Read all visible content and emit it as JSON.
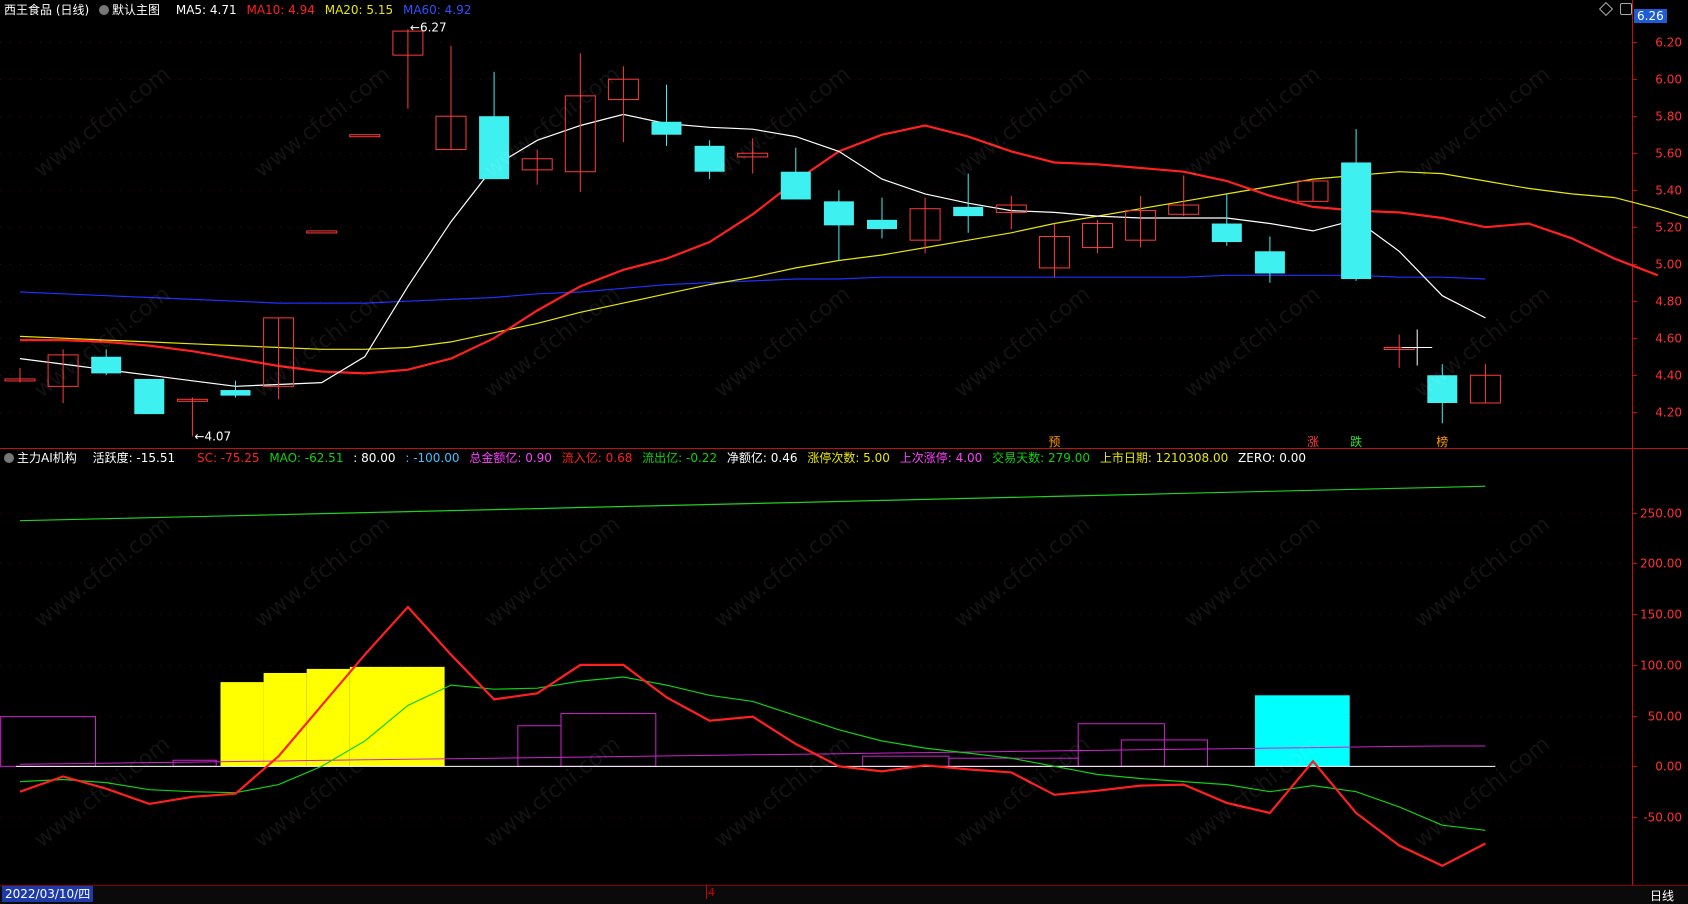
{
  "header": {
    "stock_name": "西王食品 (日线)",
    "template": "默认主图",
    "ma5": "MA5: 4.71",
    "ma10": "MA10: 4.94",
    "ma20": "MA20: 5.15",
    "ma60": "MA60: 4.92"
  },
  "current_price": "6.26",
  "indicator_header": {
    "name": "主力AI机构",
    "activity": "活跃度: -15.51",
    "sc": "SC: -75.25",
    "mao": "MAO: -62.51",
    "level80": ": 80.00",
    "level_neg100": ": -100.00",
    "total_amount": "总金额亿: 0.90",
    "inflow": "流入亿: 0.68",
    "outflow": "流出亿: -0.22",
    "net": "净额亿: 0.46",
    "limit_up_count": "涨停次数: 5.00",
    "last_limit": "上次涨停: 4.00",
    "trade_days": "交易天数: 279.00",
    "list_date": "上市日期: 1210308.00",
    "zero": "ZERO: 0.00"
  },
  "bottom": {
    "date": "2022/03/10/四",
    "period": "日线",
    "cursor_label": "4"
  },
  "watermark": "www.cfchi.com",
  "colors": {
    "up": "#ff3b3b",
    "down": "#3ff0f0",
    "ma5": "#ffffff",
    "ma10": "#ff2020",
    "ma20": "#e8e800",
    "ma60": "#2030ff",
    "sc": "#ff2020",
    "mao": "#10d010",
    "bg": "#000000",
    "axis": "#c01010"
  },
  "chart_data": [
    {
      "type": "candlestick",
      "ylim": [
        4.05,
        6.32
      ],
      "y_ticks": [
        4.2,
        4.4,
        4.6,
        4.8,
        5.0,
        5.2,
        5.4,
        5.6,
        5.8,
        6.0,
        6.2
      ],
      "annotations": [
        {
          "text": "6.27",
          "index": 9
        },
        {
          "text": "4.07",
          "index": 4
        }
      ],
      "markers": [
        {
          "text": "预",
          "index": 24,
          "color": "#ff9900"
        },
        {
          "text": "涨",
          "index": 30,
          "color": "#ff3b3b"
        },
        {
          "text": "跌",
          "index": 31,
          "color": "#30e030"
        },
        {
          "text": "榜",
          "index": 33,
          "color": "#ff9900"
        }
      ],
      "candles": [
        {
          "o": 4.37,
          "c": 4.38,
          "h": 4.44,
          "l": 4.36
        },
        {
          "o": 4.34,
          "c": 4.51,
          "h": 4.54,
          "l": 4.25
        },
        {
          "o": 4.5,
          "c": 4.41,
          "h": 4.54,
          "l": 4.4
        },
        {
          "o": 4.38,
          "c": 4.19,
          "h": 4.38,
          "l": 4.19
        },
        {
          "o": 4.27,
          "c": 4.27,
          "h": 4.28,
          "l": 4.07
        },
        {
          "o": 4.32,
          "c": 4.29,
          "h": 4.37,
          "l": 4.28
        },
        {
          "o": 4.34,
          "c": 4.71,
          "h": 4.71,
          "l": 4.27
        },
        {
          "o": 5.18,
          "c": 5.18,
          "h": 5.18,
          "l": 5.18
        },
        {
          "o": 5.7,
          "c": 5.7,
          "h": 5.7,
          "l": 5.7
        },
        {
          "o": 6.13,
          "c": 6.26,
          "h": 6.27,
          "l": 5.84
        },
        {
          "o": 5.62,
          "c": 5.8,
          "h": 6.18,
          "l": 5.62
        },
        {
          "o": 5.8,
          "c": 5.46,
          "h": 6.04,
          "l": 5.46
        },
        {
          "o": 5.51,
          "c": 5.57,
          "h": 5.62,
          "l": 5.43
        },
        {
          "o": 5.5,
          "c": 5.91,
          "h": 6.14,
          "l": 5.39
        },
        {
          "o": 5.89,
          "c": 6.0,
          "h": 6.07,
          "l": 5.66
        },
        {
          "o": 5.77,
          "c": 5.7,
          "h": 5.97,
          "l": 5.64
        },
        {
          "o": 5.64,
          "c": 5.5,
          "h": 5.67,
          "l": 5.46
        },
        {
          "o": 5.58,
          "c": 5.6,
          "h": 5.68,
          "l": 5.49
        },
        {
          "o": 5.5,
          "c": 5.35,
          "h": 5.63,
          "l": 5.35
        },
        {
          "o": 5.34,
          "c": 5.21,
          "h": 5.4,
          "l": 5.02
        },
        {
          "o": 5.24,
          "c": 5.19,
          "h": 5.36,
          "l": 5.14
        },
        {
          "o": 5.13,
          "c": 5.3,
          "h": 5.36,
          "l": 5.06
        },
        {
          "o": 5.31,
          "c": 5.26,
          "h": 5.49,
          "l": 5.17
        },
        {
          "o": 5.28,
          "c": 5.32,
          "h": 5.37,
          "l": 5.19
        },
        {
          "o": 4.98,
          "c": 5.15,
          "h": 5.22,
          "l": 4.93
        },
        {
          "o": 5.09,
          "c": 5.22,
          "h": 5.24,
          "l": 5.06
        },
        {
          "o": 5.13,
          "c": 5.29,
          "h": 5.37,
          "l": 5.09
        },
        {
          "o": 5.27,
          "c": 5.32,
          "h": 5.48,
          "l": 5.26
        },
        {
          "o": 5.22,
          "c": 5.12,
          "h": 5.38,
          "l": 5.1
        },
        {
          "o": 5.07,
          "c": 4.95,
          "h": 5.15,
          "l": 4.9
        },
        {
          "o": 5.34,
          "c": 5.45,
          "h": 5.45,
          "l": 5.34
        },
        {
          "o": 5.55,
          "c": 4.92,
          "h": 5.73,
          "l": 4.91
        },
        {
          "o": 4.55,
          "c": 4.55,
          "h": 4.62,
          "l": 4.44
        },
        {
          "o": 4.4,
          "c": 4.25,
          "h": 4.46,
          "l": 4.14
        },
        {
          "o": 4.25,
          "c": 4.4,
          "h": 4.46,
          "l": 4.25
        }
      ],
      "ma5": [
        4.49,
        4.46,
        4.43,
        4.4,
        4.37,
        4.34,
        4.35,
        4.36,
        4.5,
        4.88,
        5.23,
        5.53,
        5.67,
        5.75,
        5.81,
        5.76,
        5.74,
        5.73,
        5.69,
        5.61,
        5.46,
        5.38,
        5.33,
        5.29,
        5.28,
        5.26,
        5.25,
        5.25,
        5.25,
        5.22,
        5.18,
        5.24,
        5.07,
        4.83,
        4.71
      ],
      "ma10": [
        4.59,
        4.59,
        4.58,
        4.56,
        4.53,
        4.49,
        4.45,
        4.42,
        4.41,
        4.43,
        4.49,
        4.6,
        4.75,
        4.88,
        4.97,
        5.03,
        5.12,
        5.27,
        5.45,
        5.61,
        5.7,
        5.75,
        5.69,
        5.61,
        5.55,
        5.54,
        5.52,
        5.5,
        5.45,
        5.37,
        5.31,
        5.29,
        5.28,
        5.25,
        5.2,
        5.22,
        5.14,
        5.03,
        4.94
      ],
      "ma20": [
        4.61,
        4.6,
        4.59,
        4.58,
        4.57,
        4.56,
        4.55,
        4.54,
        4.54,
        4.55,
        4.58,
        4.63,
        4.68,
        4.74,
        4.79,
        4.84,
        4.89,
        4.93,
        4.98,
        5.02,
        5.05,
        5.09,
        5.13,
        5.17,
        5.22,
        5.26,
        5.3,
        5.34,
        5.38,
        5.42,
        5.46,
        5.48,
        5.5,
        5.49,
        5.45,
        5.41,
        5.38,
        5.36,
        5.3,
        5.23,
        5.15
      ],
      "ma60": [
        4.85,
        4.84,
        4.83,
        4.82,
        4.81,
        4.8,
        4.79,
        4.79,
        4.79,
        4.8,
        4.81,
        4.82,
        4.84,
        4.85,
        4.87,
        4.89,
        4.9,
        4.91,
        4.92,
        4.92,
        4.93,
        4.93,
        4.93,
        4.93,
        4.93,
        4.93,
        4.93,
        4.93,
        4.94,
        4.94,
        4.94,
        4.94,
        4.93,
        4.93,
        4.92
      ]
    },
    {
      "type": "line",
      "name": "主力AI机构",
      "ylim": [
        -112,
        292
      ],
      "y_ticks": [
        -50.0,
        0.0,
        50.0,
        100.0,
        150.0,
        200.0,
        250.0
      ],
      "levels": [
        80,
        0,
        -100
      ],
      "series": [
        {
          "name": "SC",
          "values": [
            -25,
            -10,
            -22,
            -37,
            -30,
            -27,
            10,
            60,
            110,
            157,
            110,
            66,
            72,
            100,
            100,
            68,
            45,
            49,
            22,
            0,
            -5,
            1,
            -3,
            -6,
            -28,
            -24,
            -19,
            -18,
            -36,
            -46,
            5,
            -46,
            -78,
            -98,
            -76
          ]
        },
        {
          "name": "MAO",
          "values": [
            -15,
            -13,
            -16,
            -23,
            -25,
            -26,
            -18,
            0,
            25,
            60,
            80,
            76,
            77,
            84,
            88,
            80,
            70,
            64,
            50,
            36,
            25,
            18,
            13,
            8,
            0,
            -8,
            -12,
            -15,
            -18,
            -25,
            -19,
            -25,
            -40,
            -58,
            -63
          ]
        },
        {
          "name": "limit_trend",
          "values": [
            242,
            243,
            244,
            245,
            246,
            247,
            248,
            249,
            250,
            251,
            252,
            253,
            254,
            255,
            256,
            257,
            258,
            259,
            260,
            261,
            262,
            263,
            264,
            265,
            266,
            267,
            268,
            269,
            270,
            271,
            272,
            273,
            274,
            275,
            276
          ]
        },
        {
          "name": "amount_line",
          "values": [
            0,
            0,
            0,
            0,
            0,
            0,
            0,
            0,
            0,
            0,
            0,
            0,
            0,
            0,
            0,
            0,
            0,
            0,
            0,
            0,
            0,
            0,
            0,
            0,
            0,
            0,
            0,
            0,
            0,
            0,
            0,
            0,
            0,
            0,
            0
          ]
        }
      ],
      "bars_yellow": [
        {
          "from": 5.0,
          "to": 6.0,
          "value": 83
        },
        {
          "from": 6.0,
          "to": 7.0,
          "value": 92
        },
        {
          "from": 7.0,
          "to": 8.0,
          "value": 96
        },
        {
          "from": 8.0,
          "to": 10.2,
          "value": 98
        }
      ],
      "bars_cyan": [
        {
          "from": 29.0,
          "to": 31.2,
          "value": 70
        }
      ],
      "boxes_magenta": [
        {
          "from": -0.1,
          "to": 2.1,
          "value": 49
        },
        {
          "from": 3.9,
          "to": 4.9,
          "value": 6
        },
        {
          "from": 11.9,
          "to": 12.9,
          "value": 40
        },
        {
          "from": 12.9,
          "to": 15.1,
          "value": 52
        },
        {
          "from": 19.9,
          "to": 21.9,
          "value": 10
        },
        {
          "from": 21.9,
          "to": 24.9,
          "value": 8
        },
        {
          "from": 24.9,
          "to": 26.9,
          "value": 42
        },
        {
          "from": 25.9,
          "to": 27.9,
          "value": 26
        }
      ]
    }
  ]
}
